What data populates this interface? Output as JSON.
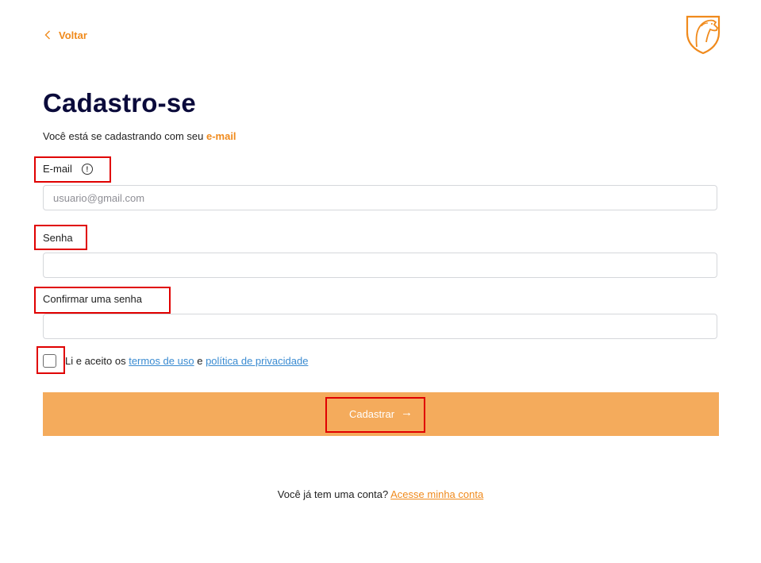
{
  "header": {
    "back_label": "Voltar",
    "back_icon": "chevron-left-icon",
    "logo_icon": "horse-shield-logo",
    "brand_color": "#f08a1c"
  },
  "page": {
    "title": "Cadastro-se",
    "subtitle_text": "Você está se cadastrando com seu ",
    "subtitle_accent": "e-mail"
  },
  "form": {
    "email_label": "E-mail",
    "email_info_icon": "info-icon",
    "email_info_glyph": "!",
    "email_value": "",
    "email_placeholder": "usuario@gmail.com",
    "password_label": "Senha",
    "password_value": "",
    "confirm_label": "Confirmar uma senha",
    "confirm_value": "",
    "terms_prefix": "Li e aceito os ",
    "terms_link": "termos de uso",
    "terms_and": " e ",
    "privacy_link": "política de privacidade",
    "terms_checked": false,
    "submit_label": "Cadastrar",
    "submit_arrow": "→",
    "submit_color": "#f4ab5c"
  },
  "footer": {
    "question": "Você já tem uma conta? ",
    "login_link": "Acesse minha conta"
  }
}
